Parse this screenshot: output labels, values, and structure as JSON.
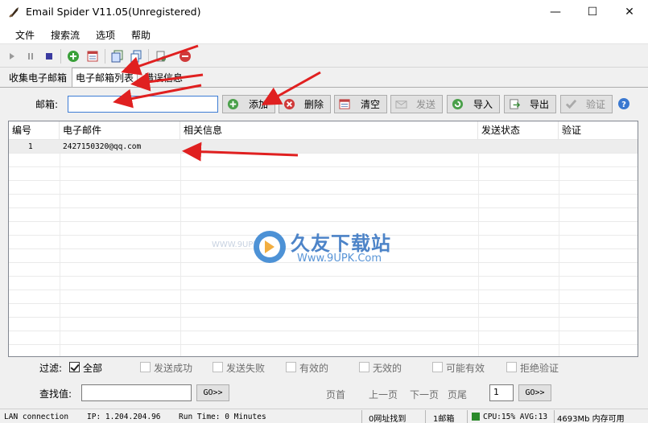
{
  "window": {
    "title": "Email Spider V11.05(Unregistered)",
    "min_glyph": "—",
    "max_glyph": "☐",
    "close_glyph": "✕"
  },
  "menu": [
    "文件",
    "搜索流",
    "选项",
    "帮助"
  ],
  "tabs": [
    "收集电子邮箱",
    "电子邮箱列表",
    "错误信息"
  ],
  "email_form": {
    "label": "邮箱:",
    "value": ""
  },
  "action_buttons": [
    "添加",
    "删除",
    "清空",
    "发送",
    "导入",
    "导出",
    "验证"
  ],
  "table": {
    "headers": [
      "编号",
      "电子邮件",
      "相关信息",
      "发送状态",
      "验证"
    ],
    "rows": [
      {
        "id": "1",
        "email": "2427150320@qq.com",
        "info": "",
        "status": "",
        "verify": ""
      }
    ]
  },
  "watermark": {
    "title": "久友下载站",
    "url": "Www.9UPK.Com",
    "side": "WWW.9UPK.COM"
  },
  "filter": {
    "label": "过滤:",
    "options": [
      "全部",
      "发送成功",
      "发送失败",
      "有效的",
      "无效的",
      "可能有效",
      "拒绝验证"
    ],
    "checked": "全部"
  },
  "search": {
    "label": "查找值:",
    "go": "GO>>"
  },
  "pager": {
    "first": "页首",
    "prev": "上一页",
    "next": "下一页",
    "last": "页尾",
    "page": "1",
    "go": "GO>>"
  },
  "status": {
    "connection": "LAN connection",
    "ip": "IP: 1.204.204.96",
    "runtime": "Run Time: 0 Minutes",
    "found": "0网址找到",
    "emails": "1邮箱",
    "cpu": "CPU:15% AVG:13",
    "memory": "4693Mb 内存可用"
  },
  "colors": {
    "accent": "#3d7cd4",
    "arrow": "#e02020",
    "cpu": "#2a8a2a"
  }
}
